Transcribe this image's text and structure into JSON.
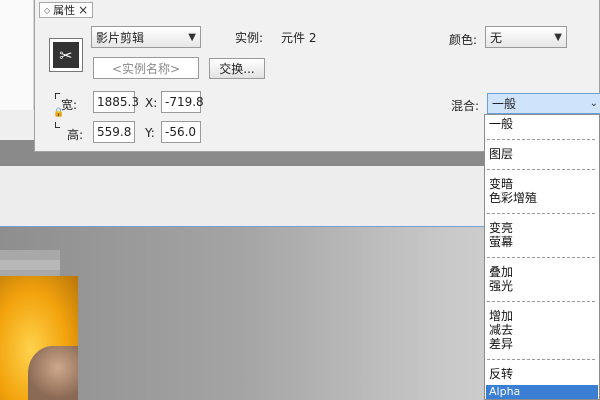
{
  "panel": {
    "tab_title": "属性",
    "type_value": "影片剪辑",
    "instance_label": "实例:",
    "instance_value": "元件 2",
    "color_label": "颜色:",
    "color_value": "无",
    "name_placeholder": "<实例名称>",
    "swap_label": "交换...",
    "width_label": "宽:",
    "width_value": "1885.3",
    "height_label": "高:",
    "height_value": "559.8",
    "x_label": "X:",
    "x_value": "-719.8",
    "y_label": "Y:",
    "y_value": "-56.0",
    "blend_label": "混合:",
    "blend_value": "一般"
  },
  "blend_options": [
    "一般",
    "图层",
    "变暗",
    "色彩增殖",
    "变亮",
    "萤幕",
    "叠加",
    "强光",
    "增加",
    "减去",
    "差异",
    "反转",
    "Alpha"
  ],
  "colors": {
    "accent": "#3b7fd4",
    "selected_select": "#cfe4fb"
  }
}
